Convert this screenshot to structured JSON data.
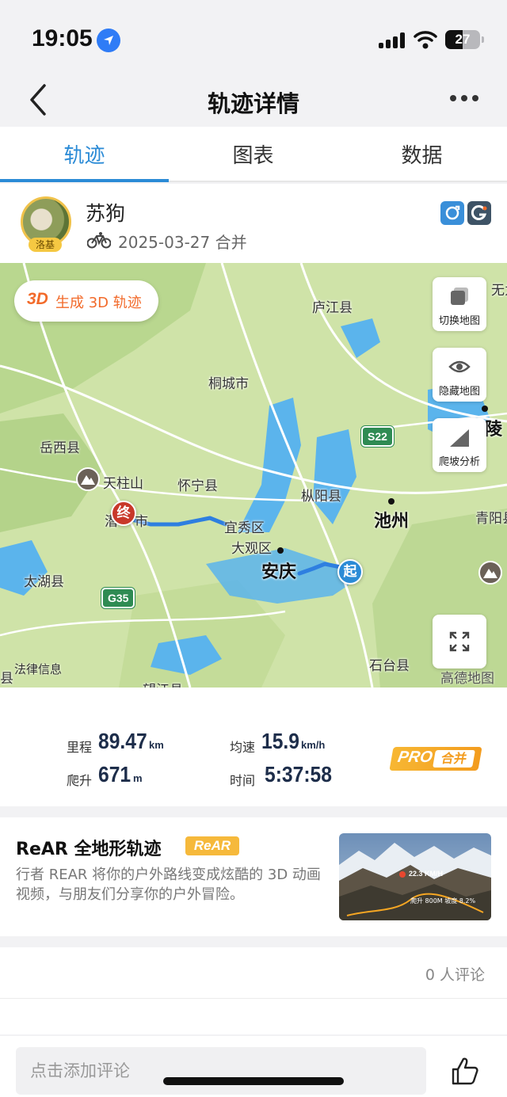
{
  "status_bar": {
    "time": "19:05",
    "battery": "27"
  },
  "nav": {
    "title": "轨迹详情"
  },
  "tabs": [
    {
      "label": "轨迹",
      "active": true
    },
    {
      "label": "图表",
      "active": false
    },
    {
      "label": "数据",
      "active": false
    }
  ],
  "user": {
    "name": "苏狗",
    "badge": "洛基",
    "date_meta": "2025-03-27 合并"
  },
  "map": {
    "btn_3d_tag": "3D",
    "btn_3d_label": "生成 3D 轨迹",
    "tools": [
      {
        "label": "切换地图",
        "icon": "layers-icon"
      },
      {
        "label": "隐藏地图",
        "icon": "eye-icon"
      },
      {
        "label": "爬坡分析",
        "icon": "slope-icon"
      }
    ],
    "labels": {
      "wuwei": "无为",
      "lujiang": "庐江县",
      "tongcheng": "桐城市",
      "yuexi": "岳西县",
      "tianzhushan": "天柱山",
      "huaining": "怀宁县",
      "zongyang": "枞阳县",
      "qian": "潜",
      "shi": "市",
      "yixiu": "宜秀区",
      "daguan": "大观区",
      "anqing": "安庆",
      "chizhou": "池州",
      "tongling": "陵",
      "qingyang": "青阳县",
      "taihu": "太湖县",
      "shitai": "石台县",
      "xian_edge": "县",
      "wangjiang": "望江县"
    },
    "roads": {
      "s22": "S22",
      "g35": "G35"
    },
    "marker_end": "终",
    "marker_start": "起",
    "legal": "法律信息",
    "provider": "高德地图",
    "colors": {
      "track": "#2e7fe0",
      "water": "#5bb4ec",
      "land": "#cfe3a8"
    }
  },
  "stats": {
    "distance": {
      "label": "里程",
      "value": "89.47",
      "unit": "km"
    },
    "speed": {
      "label": "均速",
      "value": "15.9",
      "unit": "km/h"
    },
    "climb": {
      "label": "爬升",
      "value": "671",
      "unit": "m"
    },
    "time": {
      "label": "时间",
      "value": "5:37:58"
    },
    "pro_a": "PRO",
    "pro_b": "合并"
  },
  "rear": {
    "title": "ReAR 全地形轨迹",
    "badge": "ReAR",
    "desc": "行者 REAR 将你的户外路线变成炫酷的 3D 动画视频，与朋友们分享你的户外冒险。",
    "thumb_speed": "22.3 KM/H",
    "thumb_info": "爬升 800M  坡度 8.2%"
  },
  "comments": {
    "count_text": "0 人评论"
  },
  "bottom": {
    "input_placeholder": "点击添加评论"
  }
}
